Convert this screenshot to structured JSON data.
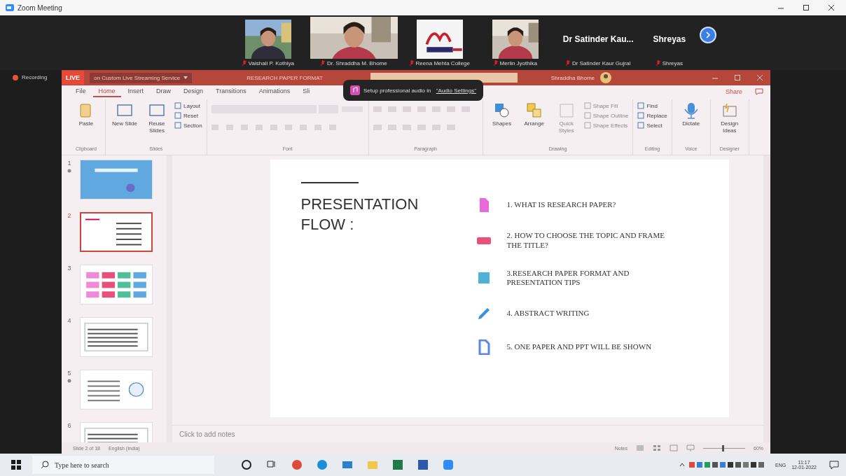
{
  "window": {
    "title": "Zoom Meeting"
  },
  "participants": [
    {
      "kind": "video",
      "name": "Vaishali P. Kothiya"
    },
    {
      "kind": "video",
      "name": "Dr. Shraddha M. Bhome"
    },
    {
      "kind": "logo",
      "name": "Reena Mehta College"
    },
    {
      "kind": "video",
      "name": "Merlin Jyothika"
    },
    {
      "kind": "name",
      "title": "Dr Satinder Kau...",
      "name": "Dr Satinder Kaur Gujral"
    },
    {
      "kind": "name",
      "title": "Shreyas",
      "name": "Shreyas"
    }
  ],
  "recording": "Recording",
  "ppt": {
    "live": "LIVE",
    "stream": "on Custom Live Streaming Service",
    "doc_title": "RESEARCH PAPER FORMAT",
    "user": "Shraddha Bhome"
  },
  "tooltip": {
    "text": "Setup professional audio in ",
    "link": "\"Audio Settings\""
  },
  "tabs": [
    {
      "label": "File",
      "selected": false
    },
    {
      "label": "Home",
      "selected": true
    },
    {
      "label": "Insert",
      "selected": false
    },
    {
      "label": "Draw",
      "selected": false
    },
    {
      "label": "Design",
      "selected": false
    },
    {
      "label": "Transitions",
      "selected": false
    },
    {
      "label": "Animations",
      "selected": false
    },
    {
      "label": "Sli",
      "selected": false
    }
  ],
  "share": "Share",
  "ribbon": [
    {
      "name": "Clipboard",
      "kind": "tools",
      "tools": [
        {
          "label": "Paste",
          "kind": "large",
          "disabled": false
        }
      ]
    },
    {
      "name": "Slides",
      "kind": "tools",
      "tools": [
        {
          "label": "New Slide",
          "kind": "large",
          "disabled": false
        },
        {
          "label": "Reuse Slides",
          "kind": "large",
          "disabled": false
        },
        {
          "label": "Layout",
          "kind": "small",
          "disabled": false
        },
        {
          "label": "Reset",
          "kind": "small",
          "disabled": false
        },
        {
          "label": "Section",
          "kind": "small",
          "disabled": false
        }
      ]
    },
    {
      "name": "Font",
      "kind": "font"
    },
    {
      "name": "Paragraph",
      "kind": "paragraph"
    },
    {
      "name": "Drawing",
      "kind": "tools",
      "tools": [
        {
          "label": "Shapes",
          "kind": "large",
          "disabled": false
        },
        {
          "label": "Arrange",
          "kind": "large",
          "disabled": false
        },
        {
          "label": "Quick Styles",
          "kind": "large",
          "disabled": true
        },
        {
          "label": "Shape Fill",
          "kind": "small",
          "disabled": true
        },
        {
          "label": "Shape Outline",
          "kind": "small",
          "disabled": true
        },
        {
          "label": "Shape Effects",
          "kind": "small",
          "disabled": true
        }
      ]
    },
    {
      "name": "Editing",
      "kind": "tools",
      "tools": [
        {
          "label": "Find",
          "kind": "small",
          "disabled": false
        },
        {
          "label": "Replace",
          "kind": "small",
          "disabled": false
        },
        {
          "label": "Select",
          "kind": "small",
          "disabled": false
        }
      ]
    },
    {
      "name": "Voice",
      "kind": "tools",
      "tools": [
        {
          "label": "Dictate",
          "kind": "large",
          "disabled": false
        }
      ]
    },
    {
      "name": "Designer",
      "kind": "tools",
      "tools": [
        {
          "label": "Design Ideas",
          "kind": "large",
          "disabled": false
        }
      ]
    }
  ],
  "thumbnails": [
    {
      "number": "1",
      "kind": "title",
      "selected": false,
      "animated": true
    },
    {
      "number": "2",
      "kind": "list",
      "selected": true,
      "animated": false
    },
    {
      "number": "3",
      "kind": "grid",
      "selected": false,
      "animated": false
    },
    {
      "number": "4",
      "kind": "text",
      "selected": false,
      "animated": false
    },
    {
      "number": "5",
      "selected": false,
      "animated": true
    },
    {
      "number": "6",
      "kind": "text",
      "selected": false,
      "animated": false
    }
  ],
  "slide": {
    "title": "PRESENTATION FLOW :",
    "items": [
      {
        "kind": "document",
        "color": "#e86ad8",
        "text": "1. WHAT IS RESEARCH PAPER?"
      },
      {
        "kind": "ticket",
        "color": "#e8507a",
        "text": "2. HOW TO CHOOSE THE TOPIC AND FRAME THE TITLE?"
      },
      {
        "kind": "table",
        "color": "#4fb0d8",
        "text": "3.RESEARCH PAPER FORMAT AND PRESENTATION TIPS"
      },
      {
        "kind": "pencil",
        "color": "#3a8fe0",
        "text": "4. ABSTRACT WRITING"
      },
      {
        "kind": "page",
        "color": "#5a86e8",
        "text": "5. ONE PAPER AND PPT WILL BE SHOWN"
      }
    ]
  },
  "notes": {
    "placeholder": "Click to add notes"
  },
  "status": {
    "slide": "Slide 2 of 18",
    "language": "English (India)",
    "notes": "Notes",
    "zoom": "60%",
    "zoom_level": {
      "level": 0.45
    }
  },
  "taskbar": {
    "search_placeholder": "Type here to search",
    "language": "ENG",
    "time": "11:17",
    "date": "12-01-2022"
  }
}
